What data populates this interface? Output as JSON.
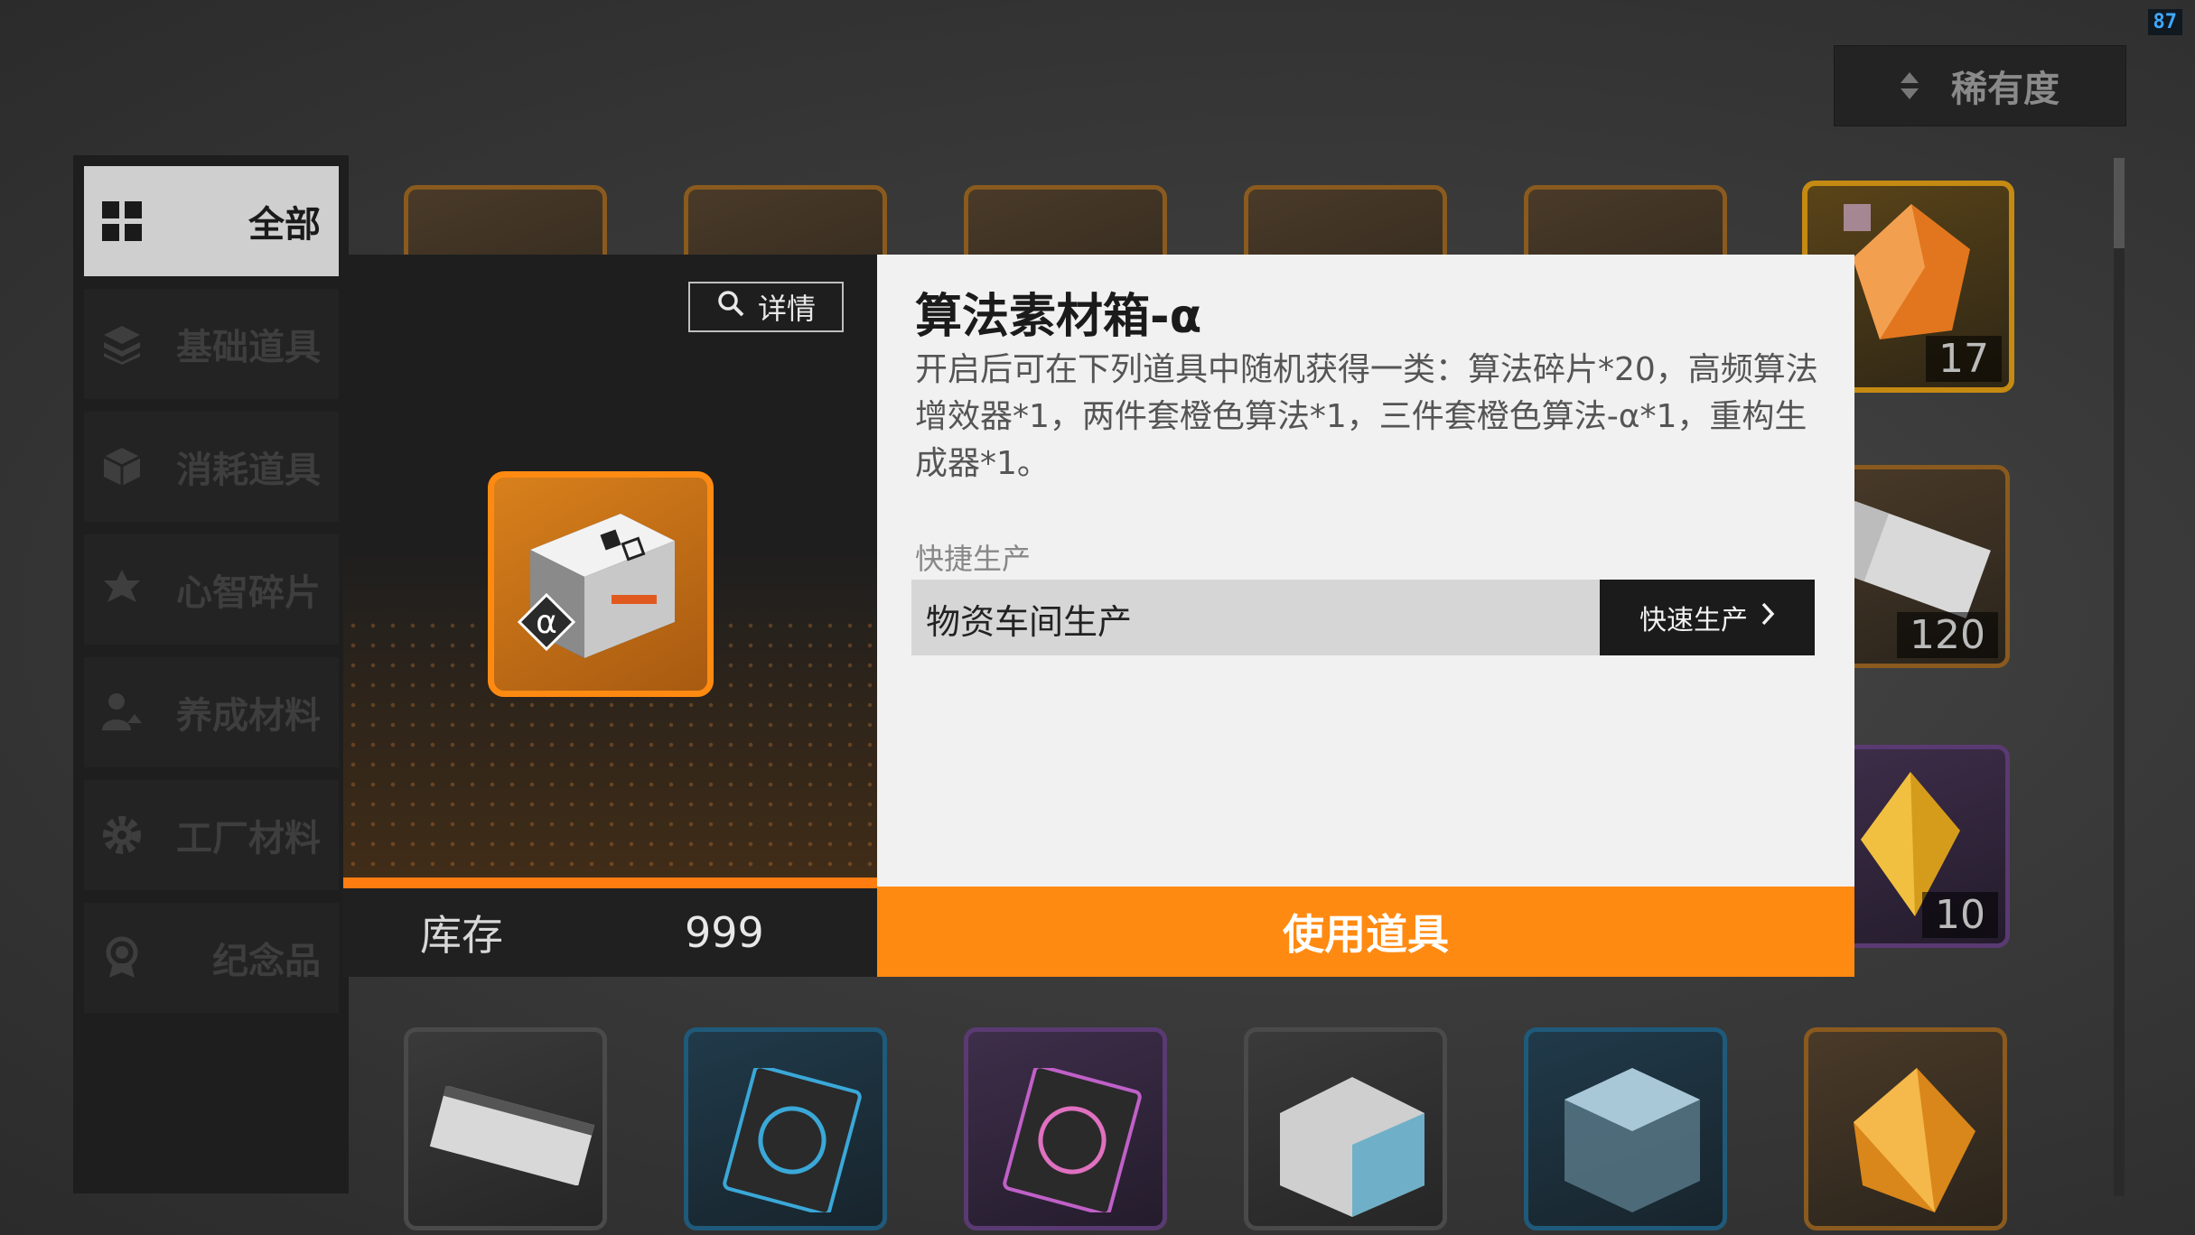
{
  "fps": "87",
  "sort": {
    "label": "稀有度"
  },
  "sidebar": {
    "items": [
      {
        "label": "全部",
        "icon": "grid-icon",
        "active": true
      },
      {
        "label": "基础道具",
        "icon": "layers-icon"
      },
      {
        "label": "消耗道具",
        "icon": "cube-icon"
      },
      {
        "label": "心智碎片",
        "icon": "puzzle-icon"
      },
      {
        "label": "养成材料",
        "icon": "person-upgrade-icon"
      },
      {
        "label": "工厂材料",
        "icon": "gear-icon"
      },
      {
        "label": "纪念品",
        "icon": "medal-icon"
      }
    ]
  },
  "grid": {
    "counts": {
      "top_right": "17",
      "mid_right": "120",
      "lower_right": "10"
    }
  },
  "modal": {
    "detail_label": "详情",
    "stock_label": "库存",
    "stock_value": "999",
    "item_title": "算法素材箱-α",
    "item_desc": "开启后可在下列道具中随机获得一类：算法碎片*20，高频算法增效器*1，两件套橙色算法*1，三件套橙色算法-α*1，重构生成器*1。",
    "quick_label": "快捷生产",
    "quick_field": "物资车间生产",
    "quick_button": "快速生产",
    "use_button": "使用道具",
    "colors": {
      "accent": "#ff8a12",
      "dark": "#1e1e1e",
      "panel": "#f1f1f1"
    }
  }
}
